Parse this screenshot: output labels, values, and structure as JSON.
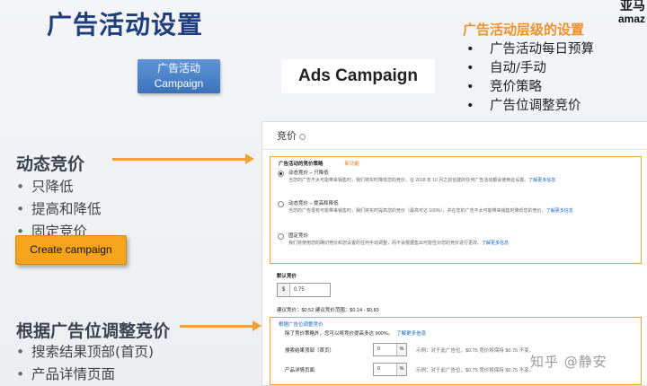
{
  "title": "广告活动设置",
  "logo": {
    "line1": "亚马",
    "line2": "amaz"
  },
  "campaign_button": {
    "line1": "广告活动",
    "line2": "Campaign"
  },
  "ads_campaign_label": "Ads Campaign",
  "right_panel": {
    "heading": "广告活动层级的设置",
    "items": [
      "广告活动每日预算",
      "自动/手动",
      "竞价策略",
      "广告位调整竞价"
    ]
  },
  "dynamic_bidding": {
    "heading": "动态竞价",
    "items": [
      "只降低",
      "提高和降低",
      "固定竞价"
    ]
  },
  "create_campaign_button": "Create campaign",
  "placement_bidding": {
    "heading": "根据广告位调整竞价",
    "items": [
      "搜索结果顶部(首页)",
      "产品详情页面"
    ]
  },
  "bidding_panel": {
    "title": "竞价",
    "strategy_label": "广告活动的竞价策略",
    "new_badge": "新功能",
    "options": [
      {
        "title": "动态竞价 – 只降低",
        "desc": "当您的广告不太可能带来销售时，我们将实时降低您的竞价。在 2018 年 10 月之前创建的任何广告活动都会使用此设置。",
        "learn_more": "了解更多信息",
        "selected": true
      },
      {
        "title": "动态竞价 – 提高和降低",
        "desc": "当您的广告很有可能带来销售时，我们将实时提高您的竞价（最高可达 100%），并在您的广告不太可能带来销售时降低您的竞价。",
        "learn_more": "了解更多信息",
        "selected": false
      },
      {
        "title": "固定竞价",
        "desc": "我们将使用您的确切竞价和您设置的任何手动调整，而不会根据售出可能性对您的竞价进行更改。",
        "learn_more": "了解更多信息",
        "selected": false
      }
    ],
    "default_bid_label": "默认竞价",
    "currency": "$",
    "default_bid_value": "0.75",
    "suggestion": "建议竞价：$0.52 建议竞价范围：$0.14 - $0.83",
    "adjust_heading": "根据广告位调整竞价",
    "adjust_sub": "除了竞价策略外，您可以将竞价提高多达 900%。",
    "adjust_learn_more": "了解更多信息",
    "rows": [
      {
        "name": "搜索结果顶部（首页）",
        "value": "0",
        "unit": "%",
        "example": "示例：对于此广告位，$0.75 竞价将保持 $0.75 不变。"
      },
      {
        "name": "产品详情页面",
        "value": "0",
        "unit": "%",
        "example": "示例：对于此广告位，$0.75 竞价将保持 $0.75 不变。"
      }
    ]
  },
  "watermark": "知乎 @静安",
  "colors": {
    "title": "#1e3f7c",
    "accent": "#f0a234",
    "button_blue": "#3c72bb",
    "create_orange": "#f7a41d"
  }
}
